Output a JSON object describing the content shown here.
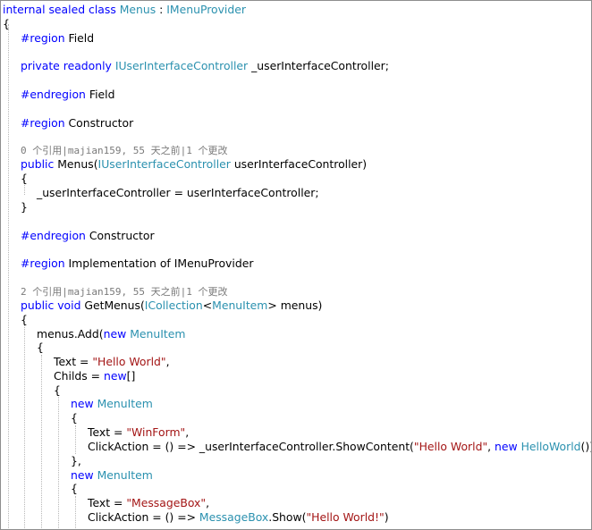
{
  "editor": {
    "lines": [
      {
        "indent": 0,
        "tokens": [
          {
            "k": "kw",
            "t": "internal sealed class "
          },
          {
            "k": "ty",
            "t": "Menus"
          },
          {
            "k": "tx",
            "t": " : "
          },
          {
            "k": "ty",
            "t": "IMenuProvider"
          }
        ]
      },
      {
        "indent": 0,
        "tokens": [
          {
            "k": "tx",
            "t": "{"
          }
        ]
      },
      {
        "indent": 20,
        "tokens": [
          {
            "k": "kw",
            "t": "#region"
          },
          {
            "k": "tx",
            "t": " Field"
          }
        ]
      },
      {
        "indent": 0,
        "tokens": []
      },
      {
        "indent": 20,
        "tokens": [
          {
            "k": "kw",
            "t": "private readonly "
          },
          {
            "k": "ty",
            "t": "IUserInterfaceController"
          },
          {
            "k": "tx",
            "t": " _userInterfaceController;"
          }
        ]
      },
      {
        "indent": 0,
        "tokens": []
      },
      {
        "indent": 20,
        "tokens": [
          {
            "k": "kw",
            "t": "#endregion"
          },
          {
            "k": "tx",
            "t": " Field"
          }
        ]
      },
      {
        "indent": 0,
        "tokens": []
      },
      {
        "indent": 20,
        "tokens": [
          {
            "k": "kw",
            "t": "#region"
          },
          {
            "k": "tx",
            "t": " Constructor"
          }
        ]
      },
      {
        "indent": 0,
        "tokens": []
      },
      {
        "indent": 20,
        "ann": true,
        "tokens": [
          {
            "k": "ann",
            "t": "0 个引用|majian159, 55 天之前|1 个更改"
          }
        ]
      },
      {
        "indent": 20,
        "tokens": [
          {
            "k": "kw",
            "t": "public "
          },
          {
            "k": "tx",
            "t": "Menus("
          },
          {
            "k": "ty",
            "t": "IUserInterfaceController"
          },
          {
            "k": "tx",
            "t": " userInterfaceController)"
          }
        ]
      },
      {
        "indent": 20,
        "tokens": [
          {
            "k": "tx",
            "t": "{"
          }
        ]
      },
      {
        "indent": 38,
        "tokens": [
          {
            "k": "tx",
            "t": "_userInterfaceController = userInterfaceController;"
          }
        ]
      },
      {
        "indent": 20,
        "tokens": [
          {
            "k": "tx",
            "t": "}"
          }
        ]
      },
      {
        "indent": 0,
        "tokens": []
      },
      {
        "indent": 20,
        "tokens": [
          {
            "k": "kw",
            "t": "#endregion"
          },
          {
            "k": "tx",
            "t": " Constructor"
          }
        ]
      },
      {
        "indent": 0,
        "tokens": []
      },
      {
        "indent": 20,
        "tokens": [
          {
            "k": "kw",
            "t": "#region"
          },
          {
            "k": "tx",
            "t": " Implementation of IMenuProvider"
          }
        ]
      },
      {
        "indent": 0,
        "tokens": []
      },
      {
        "indent": 20,
        "ann": true,
        "tokens": [
          {
            "k": "ann",
            "t": "2 个引用|majian159, 55 天之前|1 个更改"
          }
        ]
      },
      {
        "indent": 20,
        "tokens": [
          {
            "k": "kw",
            "t": "public void "
          },
          {
            "k": "tx",
            "t": "GetMenus("
          },
          {
            "k": "ty",
            "t": "ICollection"
          },
          {
            "k": "tx",
            "t": "<"
          },
          {
            "k": "ty",
            "t": "MenuItem"
          },
          {
            "k": "tx",
            "t": "> menus)"
          }
        ]
      },
      {
        "indent": 20,
        "tokens": [
          {
            "k": "tx",
            "t": "{"
          }
        ]
      },
      {
        "indent": 38,
        "tokens": [
          {
            "k": "tx",
            "t": "menus.Add("
          },
          {
            "k": "kw",
            "t": "new "
          },
          {
            "k": "ty",
            "t": "MenuItem"
          }
        ]
      },
      {
        "indent": 38,
        "tokens": [
          {
            "k": "tx",
            "t": "{"
          }
        ]
      },
      {
        "indent": 57,
        "tokens": [
          {
            "k": "tx",
            "t": "Text = "
          },
          {
            "k": "st",
            "t": "\"Hello World\""
          },
          {
            "k": "tx",
            "t": ","
          }
        ]
      },
      {
        "indent": 57,
        "tokens": [
          {
            "k": "tx",
            "t": "Childs = "
          },
          {
            "k": "kw",
            "t": "new"
          },
          {
            "k": "tx",
            "t": "[]"
          }
        ]
      },
      {
        "indent": 57,
        "tokens": [
          {
            "k": "tx",
            "t": "{"
          }
        ]
      },
      {
        "indent": 76,
        "tokens": [
          {
            "k": "kw",
            "t": "new "
          },
          {
            "k": "ty",
            "t": "MenuItem"
          }
        ]
      },
      {
        "indent": 76,
        "tokens": [
          {
            "k": "tx",
            "t": "{"
          }
        ]
      },
      {
        "indent": 95,
        "tokens": [
          {
            "k": "tx",
            "t": "Text = "
          },
          {
            "k": "st",
            "t": "\"WinForm\""
          },
          {
            "k": "tx",
            "t": ","
          }
        ]
      },
      {
        "indent": 95,
        "tokens": [
          {
            "k": "tx",
            "t": "ClickAction = () => _userInterfaceController.ShowContent("
          },
          {
            "k": "st",
            "t": "\"Hello World\""
          },
          {
            "k": "tx",
            "t": ", "
          },
          {
            "k": "kw",
            "t": "new "
          },
          {
            "k": "ty",
            "t": "HelloWorld"
          },
          {
            "k": "tx",
            "t": "())"
          }
        ]
      },
      {
        "indent": 76,
        "tokens": [
          {
            "k": "tx",
            "t": "},"
          }
        ]
      },
      {
        "indent": 76,
        "tokens": [
          {
            "k": "kw",
            "t": "new "
          },
          {
            "k": "ty",
            "t": "MenuItem"
          }
        ]
      },
      {
        "indent": 76,
        "tokens": [
          {
            "k": "tx",
            "t": "{"
          }
        ]
      },
      {
        "indent": 95,
        "tokens": [
          {
            "k": "tx",
            "t": "Text = "
          },
          {
            "k": "st",
            "t": "\"MessageBox\""
          },
          {
            "k": "tx",
            "t": ","
          }
        ]
      },
      {
        "indent": 95,
        "tokens": [
          {
            "k": "tx",
            "t": "ClickAction = () => "
          },
          {
            "k": "ty",
            "t": "MessageBox"
          },
          {
            "k": "tx",
            "t": ".Show("
          },
          {
            "k": "st",
            "t": "\"Hello World!\""
          },
          {
            "k": "tx",
            "t": ")"
          }
        ]
      }
    ]
  },
  "colors": {
    "keyword": "#0000ff",
    "type": "#2b91af",
    "string": "#a31515",
    "text": "#000000",
    "annotation": "#7a7a7a"
  }
}
